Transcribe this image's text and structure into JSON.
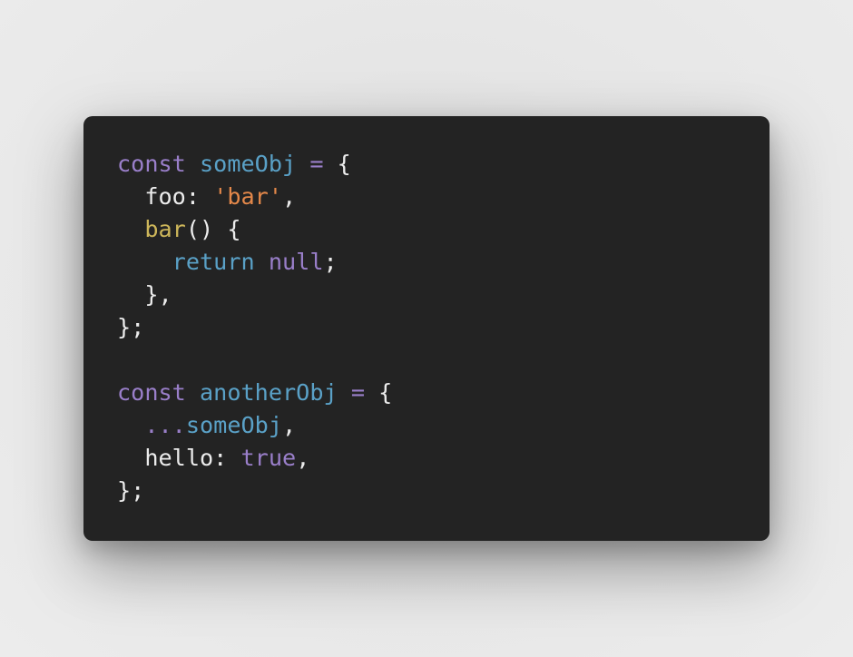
{
  "code": {
    "line1": {
      "kw": "const",
      "name": "someObj",
      "op": "=",
      "brace": "{"
    },
    "line2": {
      "prop": "foo",
      "colon": ":",
      "str": "'bar'",
      "comma": ","
    },
    "line3": {
      "fn": "bar",
      "paren": "()",
      "brace": "{"
    },
    "line4": {
      "kw": "return",
      "lit": "null",
      "semi": ";"
    },
    "line5": {
      "close": "},"
    },
    "line6": {
      "close": "};"
    },
    "line8": {
      "kw": "const",
      "name": "anotherObj",
      "op": "=",
      "brace": "{"
    },
    "line9": {
      "spread": "...",
      "name": "someObj",
      "comma": ","
    },
    "line10": {
      "prop": "hello",
      "colon": ":",
      "lit": "true",
      "comma": ","
    },
    "line11": {
      "close": "};"
    }
  },
  "colors": {
    "background": "#232323",
    "keyword": "#9a7fca",
    "identifier": "#5aa1c7",
    "string": "#e4884a",
    "function": "#cdb65a",
    "text": "#ececec"
  }
}
